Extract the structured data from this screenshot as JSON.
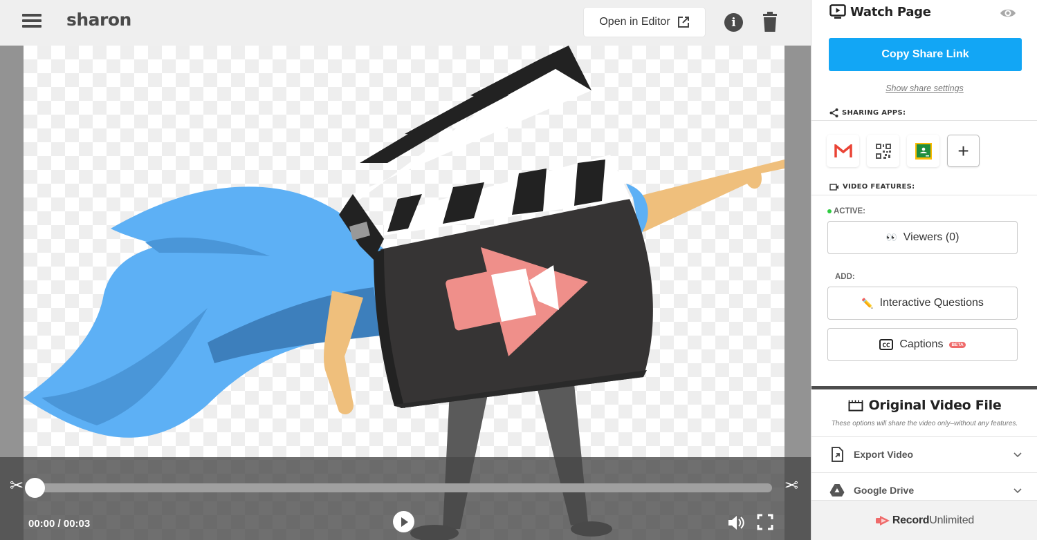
{
  "header": {
    "title": "sharon",
    "open_in_editor_label": "Open in Editor",
    "icons": {
      "menu": "hamburger-menu-icon",
      "external": "external-link-icon",
      "info": "info-icon",
      "trash": "trash-icon"
    }
  },
  "player": {
    "current_time": "00:00",
    "duration": "00:03",
    "time_display": "00:00 / 00:03",
    "progress_fraction": 0,
    "icons": {
      "trim_start": "scissors-icon",
      "trim_end": "scissors-icon",
      "play": "play-icon",
      "volume": "volume-icon",
      "fullscreen": "fullscreen-icon"
    }
  },
  "sidebar": {
    "watch_page": {
      "title": "Watch Page",
      "copy_link_label": "Copy Share Link",
      "share_settings_label": "Show share settings",
      "icons": {
        "title": "watch-page-icon",
        "preview": "eye-icon"
      }
    },
    "sharing_apps": {
      "label": "SHARING APPS:",
      "apps": [
        {
          "name": "Gmail",
          "icon": "gmail-icon"
        },
        {
          "name": "QR Code",
          "icon": "qr-code-icon"
        },
        {
          "name": "Google Classroom",
          "icon": "google-classroom-icon"
        },
        {
          "name": "Add app",
          "icon": "plus-icon",
          "symbol": "+"
        }
      ]
    },
    "video_features": {
      "label": "VIDEO FEATURES:",
      "active_label": "ACTIVE:",
      "add_label": "ADD:",
      "active": [
        {
          "emoji": "👀",
          "label": "Viewers (0)"
        }
      ],
      "add": [
        {
          "emoji": "✏️",
          "label": "Interactive Questions"
        },
        {
          "icon": "cc-icon",
          "label": "Captions",
          "badge": "BETA"
        }
      ]
    },
    "original_file": {
      "title": "Original Video File",
      "subtitle": "These options will share the video only–without any features.",
      "options": [
        {
          "label": "Export Video",
          "icon": "export-file-icon"
        },
        {
          "label": "Google Drive",
          "icon": "google-drive-icon"
        }
      ]
    },
    "footer": {
      "brand_bold": "Record",
      "brand_light": "Unlimited"
    }
  },
  "colors": {
    "accent": "#12a6f5",
    "active_dot": "#2ecc40",
    "beta_badge": "#ef6a6a",
    "brand": "#ef6a6a"
  }
}
